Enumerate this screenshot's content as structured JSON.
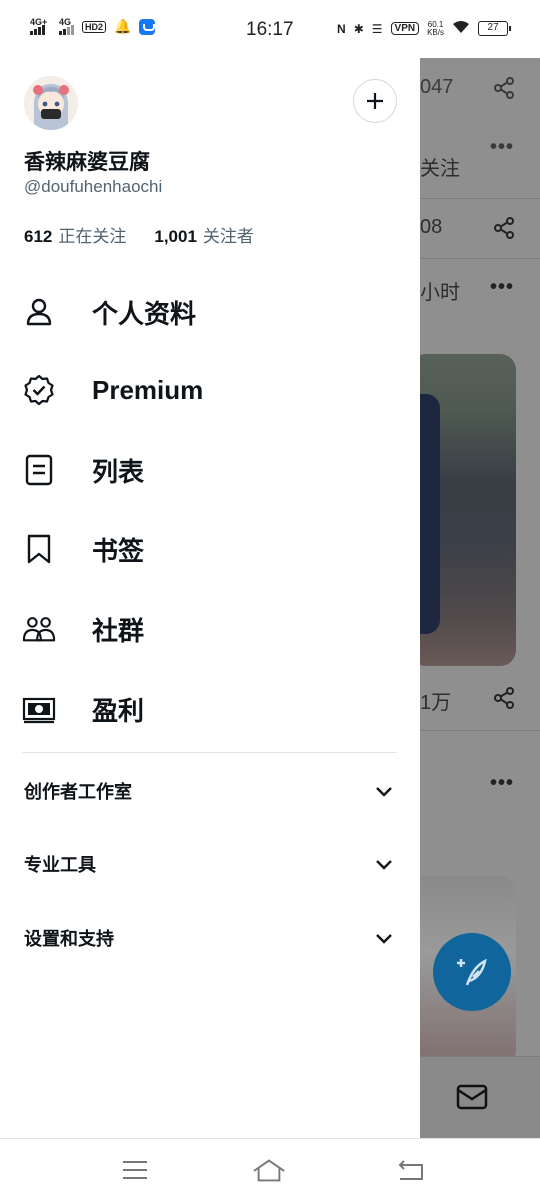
{
  "status_bar": {
    "signal1": "4G+",
    "signal2": "4G",
    "hd": "HD2",
    "time": "16:17",
    "vpn": "VPN",
    "speed_value": "60.1",
    "speed_unit": "KB/s",
    "battery": "27"
  },
  "profile": {
    "display_name": "香辣麻婆豆腐",
    "handle": "@doufuhenhaochi",
    "following_count": "612",
    "following_label": "正在关注",
    "followers_count": "1,001",
    "followers_label": "关注者"
  },
  "menu": [
    {
      "label": "个人资料",
      "icon": "person-icon"
    },
    {
      "label": "Premium",
      "icon": "verified-badge-icon"
    },
    {
      "label": "列表",
      "icon": "list-icon"
    },
    {
      "label": "书签",
      "icon": "bookmark-icon"
    },
    {
      "label": "社群",
      "icon": "communities-icon"
    },
    {
      "label": "盈利",
      "icon": "monetization-icon"
    }
  ],
  "sections": [
    {
      "label": "创作者工作室"
    },
    {
      "label": "专业工具"
    },
    {
      "label": "设置和支持"
    }
  ],
  "background": {
    "t1": "047",
    "t2": "关注",
    "t3": "08",
    "t4": "小时",
    "t5": "1万"
  },
  "colors": {
    "accent": "#1d9bf0",
    "text_primary": "#0f1419",
    "text_secondary": "#536471",
    "divider": "#e1e6e9",
    "scrim": "#8f8f8f"
  }
}
